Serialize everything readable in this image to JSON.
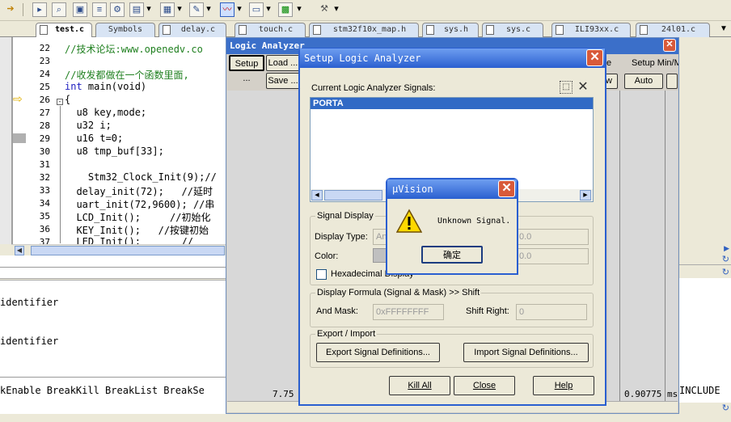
{
  "toolbar": {
    "icons": [
      "arrow-icon",
      "run-icon",
      "search-icon",
      "view-icon",
      "list-icon",
      "tools-icon",
      "dropdown-icon",
      "window-icon",
      "dropdown-icon",
      "edit-icon",
      "dropdown-icon",
      "analyzer-icon",
      "dropdown-icon",
      "memory-icon",
      "dropdown-icon",
      "chip-icon",
      "dropdown-icon",
      "wrench-icon",
      "dropdown-icon"
    ]
  },
  "tabs": [
    "test.c",
    "Symbols",
    "delay.c",
    "touch.c",
    "stm32f10x_map.h",
    "sys.h",
    "sys.c",
    "ILI93xx.c",
    "24l01.c"
  ],
  "editor": {
    "line_numbers": [
      "22",
      "23",
      "24",
      "25",
      "26",
      "27",
      "28",
      "29",
      "30",
      "31",
      "32",
      "33",
      "34",
      "35",
      "36",
      "37"
    ],
    "lines": [
      "//技术论坛:www.openedv.co",
      "",
      "//收发都做在一个函数里面,",
      "int main(void)",
      "{",
      "  u8 key,mode;",
      "  u32 i;",
      "  u16 t=0;",
      "  u8 tmp_buf[33];",
      "",
      "    Stm32_Clock_Init(9);//",
      "  delay_init(72);   //延时",
      "  uart_init(72,9600); //串",
      "  LCD_Init();     //初始化",
      "  KEY_Init();   //按键初始",
      "  LED_Init();       //"
    ]
  },
  "output": {
    "line1": "identifier",
    "line2": "identifier",
    "command_line": "kEnable BreakKill BreakList BreakSe",
    "right_text": "INCLUDE"
  },
  "logic_analyzer": {
    "title": "Logic Analyzer",
    "setup_button": "Setup ...",
    "load_button": "Load ...",
    "save_button": "Save ...",
    "right_header_partial": "e",
    "setup_minmax": "Setup Min/M",
    "auto_button": "Auto",
    "w_button": "w",
    "time_left": "7.75",
    "time_right": "0.90775 ms"
  },
  "setup_dialog": {
    "title": "Setup Logic Analyzer",
    "signals_label": "Current Logic Analyzer Signals:",
    "signals": [
      "PORTA"
    ],
    "signal_display_label": "Signal Display",
    "display_type_label": "Display Type:",
    "display_type_value": "An",
    "color_label": "Color:",
    "min_value": "0.0",
    "max_value": "0.0",
    "hex_label": "Hexadecimal Display",
    "formula_label": "Display Formula (Signal & Mask) >> Shift",
    "and_mask_label": "And Mask:",
    "and_mask_value": "0xFFFFFFFF",
    "shift_right_label": "Shift Right:",
    "shift_right_value": "0",
    "export_import_label": "Export / Import",
    "export_button": "Export Signal Definitions...",
    "import_button": "Import Signal Definitions...",
    "kill_all_button": "Kill All",
    "close_button": "Close",
    "help_button": "Help"
  },
  "message_box": {
    "title": "µVision",
    "message": "Unknown Signal.",
    "ok_button": "确定"
  }
}
